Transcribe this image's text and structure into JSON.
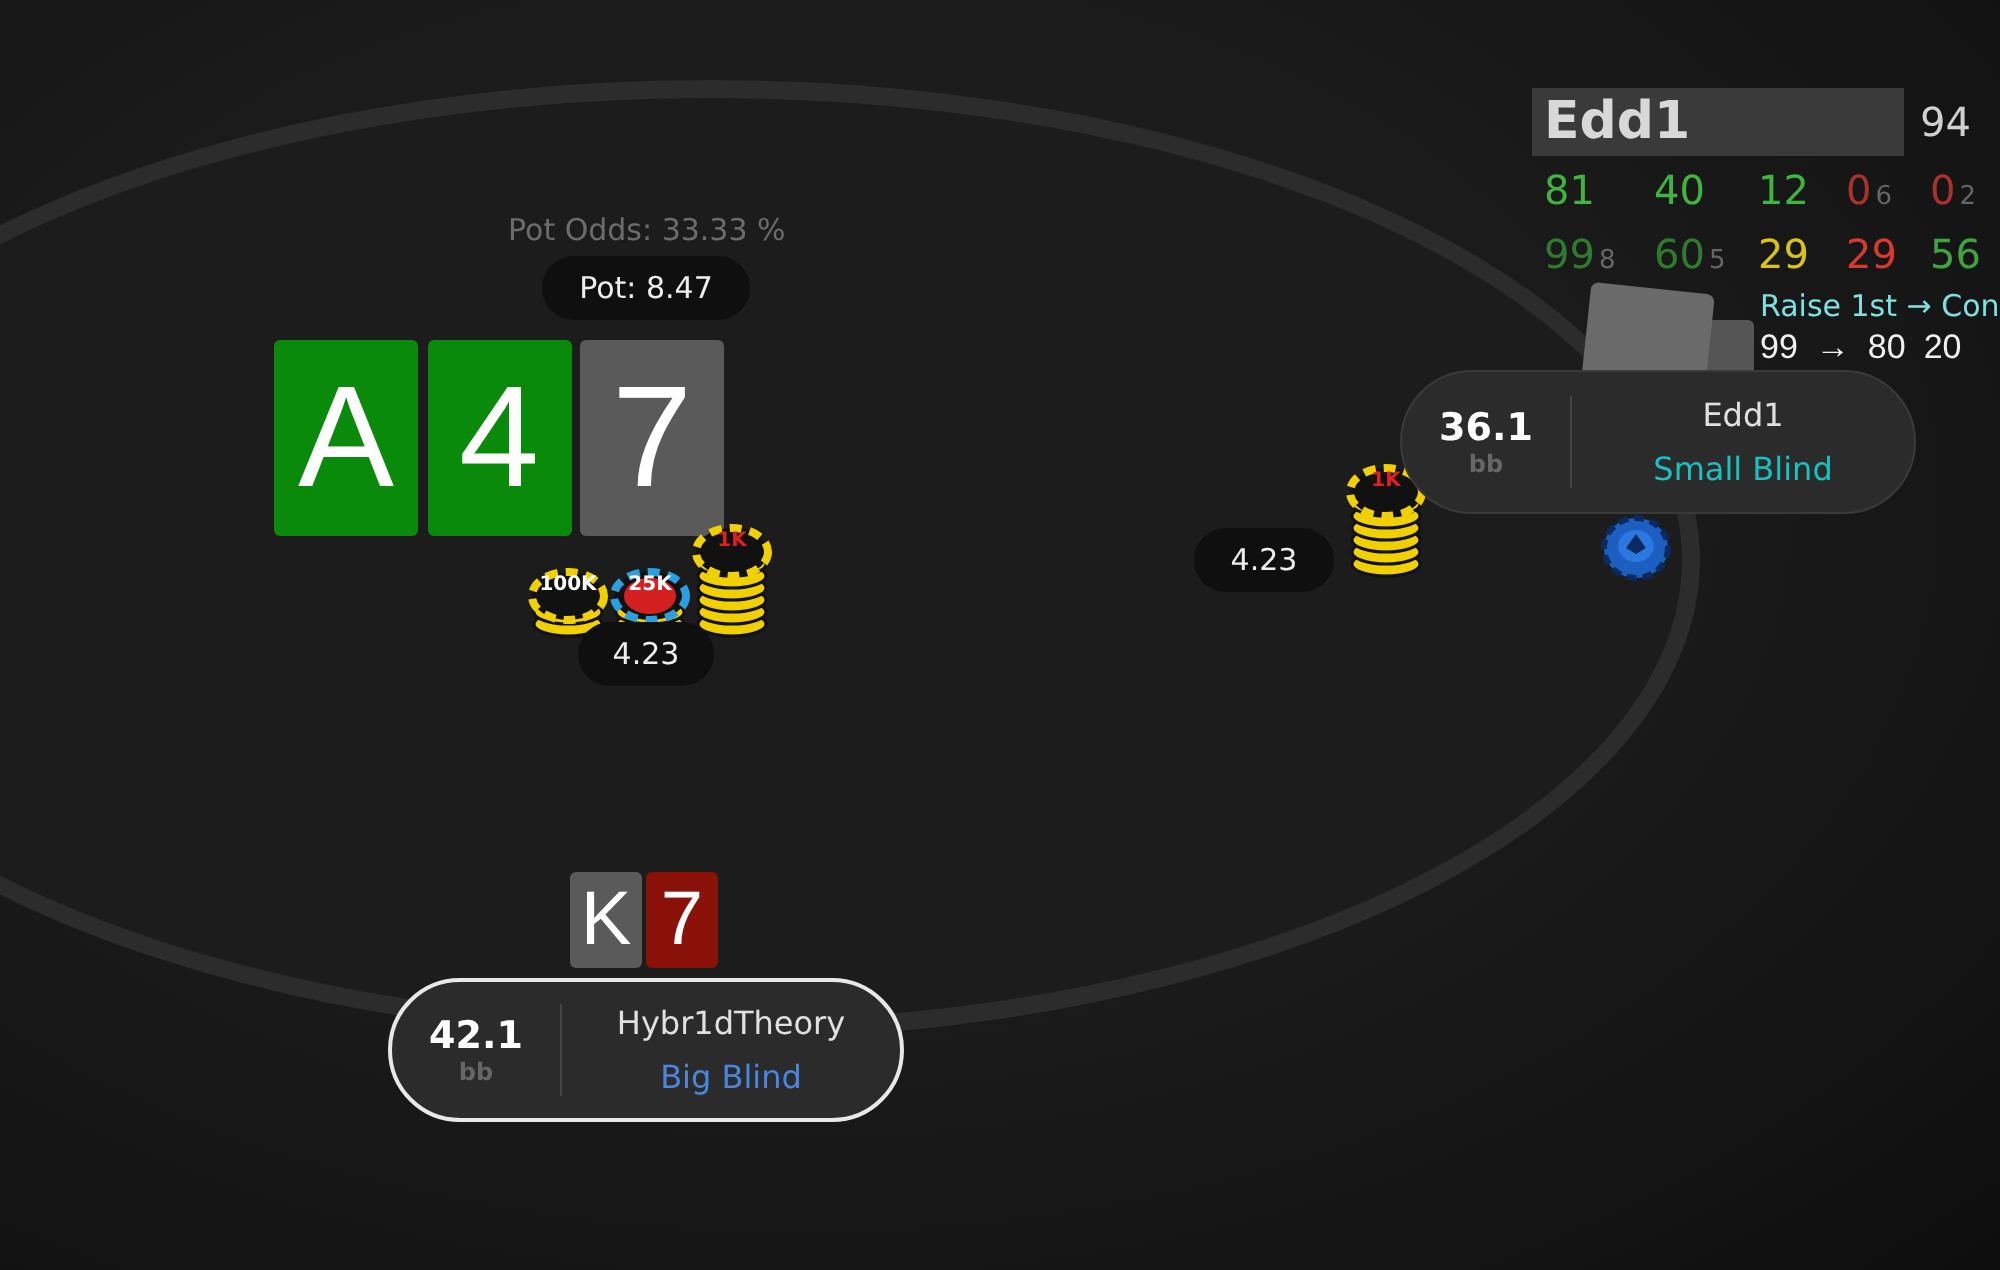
{
  "hud": {
    "player": "Edd1",
    "count": "94",
    "row_1": [
      {
        "text": "81",
        "color": "#3fb53f"
      },
      {
        "text": "40",
        "color": "#3fb53f"
      },
      {
        "text": "12",
        "color": "#3fb53f"
      },
      {
        "text": "0",
        "sub": "6",
        "color": "#a8332a"
      },
      {
        "text": "0",
        "sub": "2",
        "color": "#a8332a"
      }
    ],
    "row_2": [
      {
        "text": "99",
        "sub": "8",
        "color": "#2f7a2f"
      },
      {
        "text": "60",
        "sub": "5",
        "color": "#2f7a2f"
      },
      {
        "text": "29",
        "color": "#d9c415"
      },
      {
        "text": "29",
        "color": "#d93a2e"
      },
      {
        "text": "56",
        "color": "#3fa33f"
      }
    ],
    "line_label": "Raise 1st → Con",
    "line_values": [
      "99",
      "→",
      "80",
      "20"
    ]
  },
  "pot_odds": "Pot Odds: 33.33 %",
  "pot": "Pot: 8.47",
  "board": [
    {
      "rank": "A",
      "color": "#0a8a0a"
    },
    {
      "rank": "4",
      "color": "#0a8a0a"
    },
    {
      "rank": "7",
      "color": "#5a5a5a"
    }
  ],
  "board_bet": {
    "amount": "4.23",
    "chips": [
      "100K",
      "25K",
      "1K"
    ]
  },
  "opponent": {
    "stack": "36.1",
    "unit": "bb",
    "name": "Edd1",
    "position": "Small Blind",
    "color": "#19c2c2",
    "active": false,
    "dealer": true,
    "bet": "4.23",
    "chips": [
      "1K"
    ]
  },
  "hero": {
    "cards": [
      {
        "rank": "K",
        "color": "#5a5a5a"
      },
      {
        "rank": "7",
        "color": "#8a1208"
      }
    ],
    "stack": "42.1",
    "unit": "bb",
    "name": "Hybr1dTheory",
    "position": "Big Blind",
    "color": "#4a86e0",
    "active": true
  }
}
